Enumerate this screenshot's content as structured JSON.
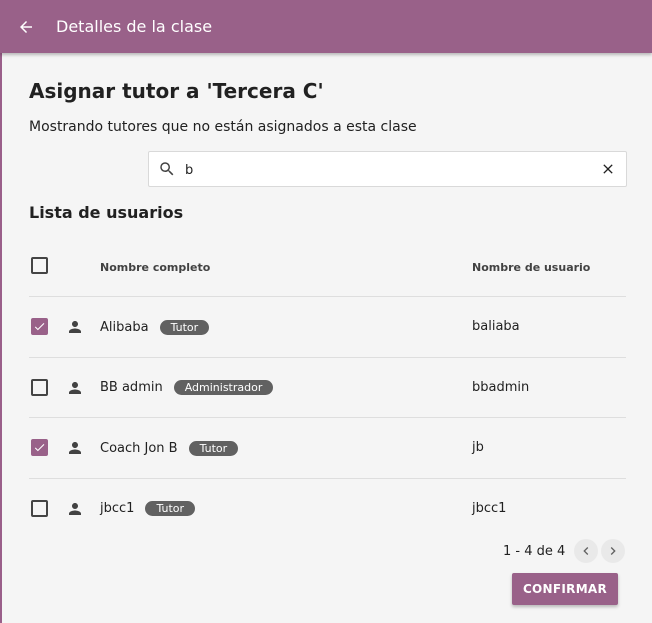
{
  "appbar": {
    "title": "Detalles de la clase",
    "back_icon": "arrow-left-icon",
    "color": "#996189"
  },
  "main": {
    "title": "Asignar tutor a 'Tercera C'",
    "subtitle": "Mostrando tutores que no están asignados a esta clase",
    "search": {
      "value": "b",
      "placeholder": ""
    },
    "list_title": "Lista de usuarios"
  },
  "table": {
    "columns": [
      "Nombre completo",
      "Nombre de usuario"
    ],
    "select_all_checked": false,
    "rows": [
      {
        "name": "Alibaba",
        "role": "Tutor",
        "username": "baliaba",
        "checked": true
      },
      {
        "name": "BB admin",
        "role": "Administrador",
        "username": "bbadmin",
        "checked": false
      },
      {
        "name": "Coach Jon B",
        "role": "Tutor",
        "username": "jb",
        "checked": true
      },
      {
        "name": "jbcc1",
        "role": "Tutor",
        "username": "jbcc1",
        "checked": false
      }
    ]
  },
  "pagination": {
    "text": "1 - 4 de 4"
  },
  "actions": {
    "confirm_label": "CONFIRMAR"
  },
  "colors": {
    "accent": "#996189",
    "badge": "#616161",
    "background": "#f5f5f5"
  }
}
